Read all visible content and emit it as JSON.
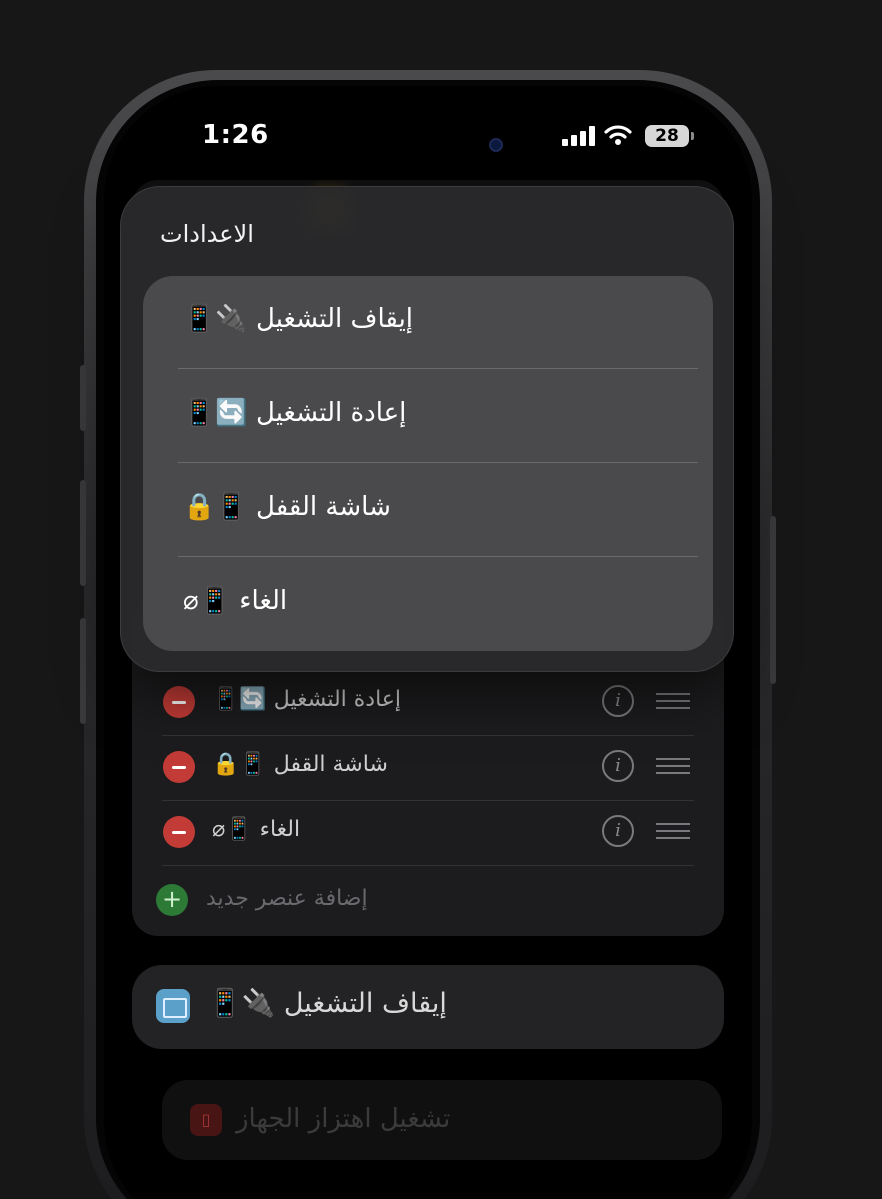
{
  "status_bar": {
    "time": "1:26",
    "battery": "28",
    "wifi_icon": "wifi-icon",
    "signal_icon": "cellular-signal-icon"
  },
  "popup": {
    "title": "الاعدادات",
    "items": [
      {
        "label": "إيقاف التشغيل 🔌📱"
      },
      {
        "label": "إعادة التشغيل 🔄📱"
      },
      {
        "label": "شاشة القفل 📱🔒"
      },
      {
        "label": "الغاء 📱⌀"
      }
    ]
  },
  "list": {
    "rows": [
      {
        "label": "إعادة التشغيل 🔄📱"
      },
      {
        "label": "شاشة القفل 📱🔒"
      },
      {
        "label": "الغاء 📱⌀"
      }
    ],
    "add_label": "إضافة عنصر جديد"
  },
  "shortcut": {
    "label": "إيقاف التشغيل 🔌📱"
  },
  "faded": {
    "label": "تشغيل اهتزاز الجهاز"
  },
  "colors": {
    "background": "#171717",
    "remove_red": "#c33b36",
    "add_green": "#2c7a36",
    "app_icon_blue": "#5aa0c8"
  }
}
